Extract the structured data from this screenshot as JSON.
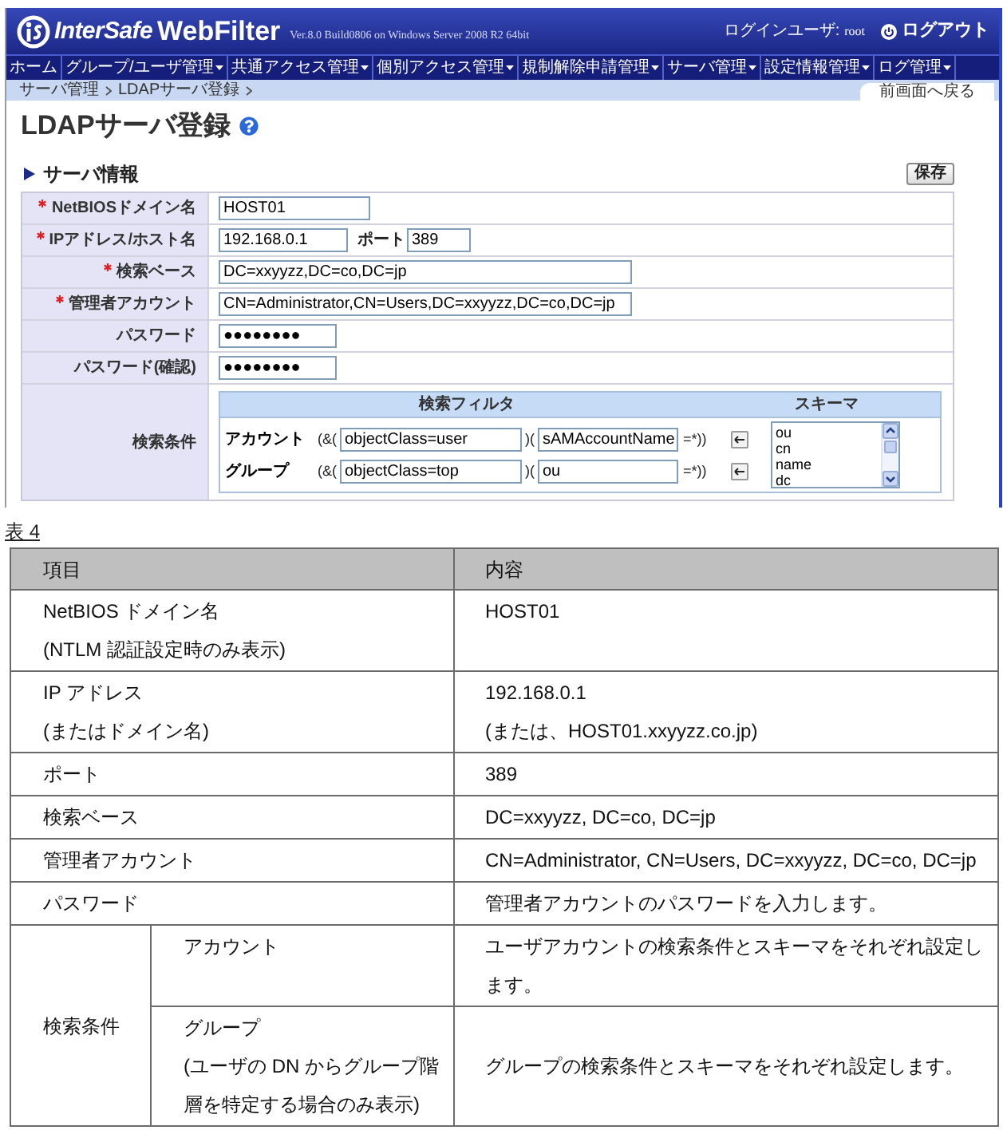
{
  "app": {
    "header": {
      "logo_name": "InterSafe",
      "logo_product": "WebFilter",
      "version": "Ver.8.0 Build0806 on Windows Server 2008 R2 64bit",
      "login_label": "ログインユーザ:",
      "login_user": "root",
      "logout": "ログアウト"
    },
    "nav": [
      {
        "label": "ホーム",
        "has_menu": false
      },
      {
        "label": "グループ/ユーザ管理",
        "has_menu": true
      },
      {
        "label": "共通アクセス管理",
        "has_menu": true
      },
      {
        "label": "個別アクセス管理",
        "has_menu": true
      },
      {
        "label": "規制解除申請管理",
        "has_menu": true
      },
      {
        "label": "サーバ管理",
        "has_menu": true
      },
      {
        "label": "設定情報管理",
        "has_menu": true
      },
      {
        "label": "ログ管理",
        "has_menu": true
      }
    ],
    "breadcrumb": [
      "サーバ管理",
      "LDAPサーバ登録"
    ],
    "back_link": "前画面へ戻る",
    "page_title": "LDAPサーバ登録",
    "section_title": "サーバ情報",
    "save_button": "保存",
    "form_rows": [
      {
        "kind": "text",
        "label": "NetBIOSドメイン名",
        "required": true,
        "value": "HOST01"
      },
      {
        "kind": "host_port",
        "label": "IPアドレス/ホスト名",
        "required": true,
        "value": "192.168.0.1",
        "port_label": "ポート",
        "port_value": "389"
      },
      {
        "kind": "long_text",
        "label": "検索ベース",
        "required": true,
        "value": "DC=xxyyzz,DC=co,DC=jp"
      },
      {
        "kind": "long_text",
        "label": "管理者アカウント",
        "required": true,
        "value": "CN=Administrator,CN=Users,DC=xxyyzz,DC=co,DC=jp"
      },
      {
        "kind": "password",
        "label": "パスワード",
        "required": false,
        "value": "●●●●●●●●"
      },
      {
        "kind": "password",
        "label": "パスワード(確認)",
        "required": false,
        "value": "●●●●●●●●"
      },
      {
        "kind": "search",
        "label": "検索条件",
        "required": false,
        "filter_header": "検索フィルタ",
        "schema_header": "スキーマ",
        "filters": [
          {
            "label": "アカウント",
            "prefix": "(&(",
            "class_value": "objectClass=user",
            "separator": ")(",
            "attribute_value": "sAMAccountName",
            "suffix": "=*))"
          },
          {
            "label": "グループ",
            "prefix": "(&(",
            "class_value": "objectClass=top",
            "separator": ")(",
            "attribute_value": "ou",
            "suffix": "=*))"
          }
        ],
        "schema_options": [
          {
            "label": "ou",
            "selected": false
          },
          {
            "label": "cn",
            "selected": false
          },
          {
            "label": "name",
            "selected": false
          },
          {
            "label": "dc",
            "selected": false
          }
        ]
      }
    ]
  },
  "table": {
    "caption": "表 4",
    "columns": [
      "項目",
      "内容"
    ],
    "rows": [
      {
        "item": [
          "NetBIOS ドメイン名",
          "(NTLM 認証設定時のみ表示)"
        ],
        "content": [
          "HOST01"
        ]
      },
      {
        "item": [
          "IP アドレス",
          "(またはドメイン名)"
        ],
        "content": [
          "192.168.0.1",
          "(または、HOST01.xxyyzz.co.jp)"
        ]
      },
      {
        "item": [
          "ポート"
        ],
        "content": [
          "389"
        ]
      },
      {
        "item": [
          "検索ベース"
        ],
        "content": [
          "DC=xxyyzz, DC=co, DC=jp"
        ]
      },
      {
        "item": [
          "管理者アカウント"
        ],
        "content": [
          "CN=Administrator, CN=Users, DC=xxyyzz, DC=co, DC=jp"
        ]
      },
      {
        "item": [
          "パスワード"
        ],
        "content": [
          "管理者アカウントのパスワードを入力します。"
        ]
      },
      {
        "item": [
          "検索条件"
        ],
        "sub_rows": [
          {
            "item": [
              "アカウント"
            ],
            "content": [
              "ユーザアカウントの検索条件とスキーマをそれぞれ設定します。"
            ]
          },
          {
            "item": [
              "グループ",
              "(ユーザの DN からグループ階層を特定する場合のみ表示)"
            ],
            "content": [
              "グループの検索条件とスキーマをそれぞれ設定します。"
            ]
          }
        ]
      }
    ]
  }
}
